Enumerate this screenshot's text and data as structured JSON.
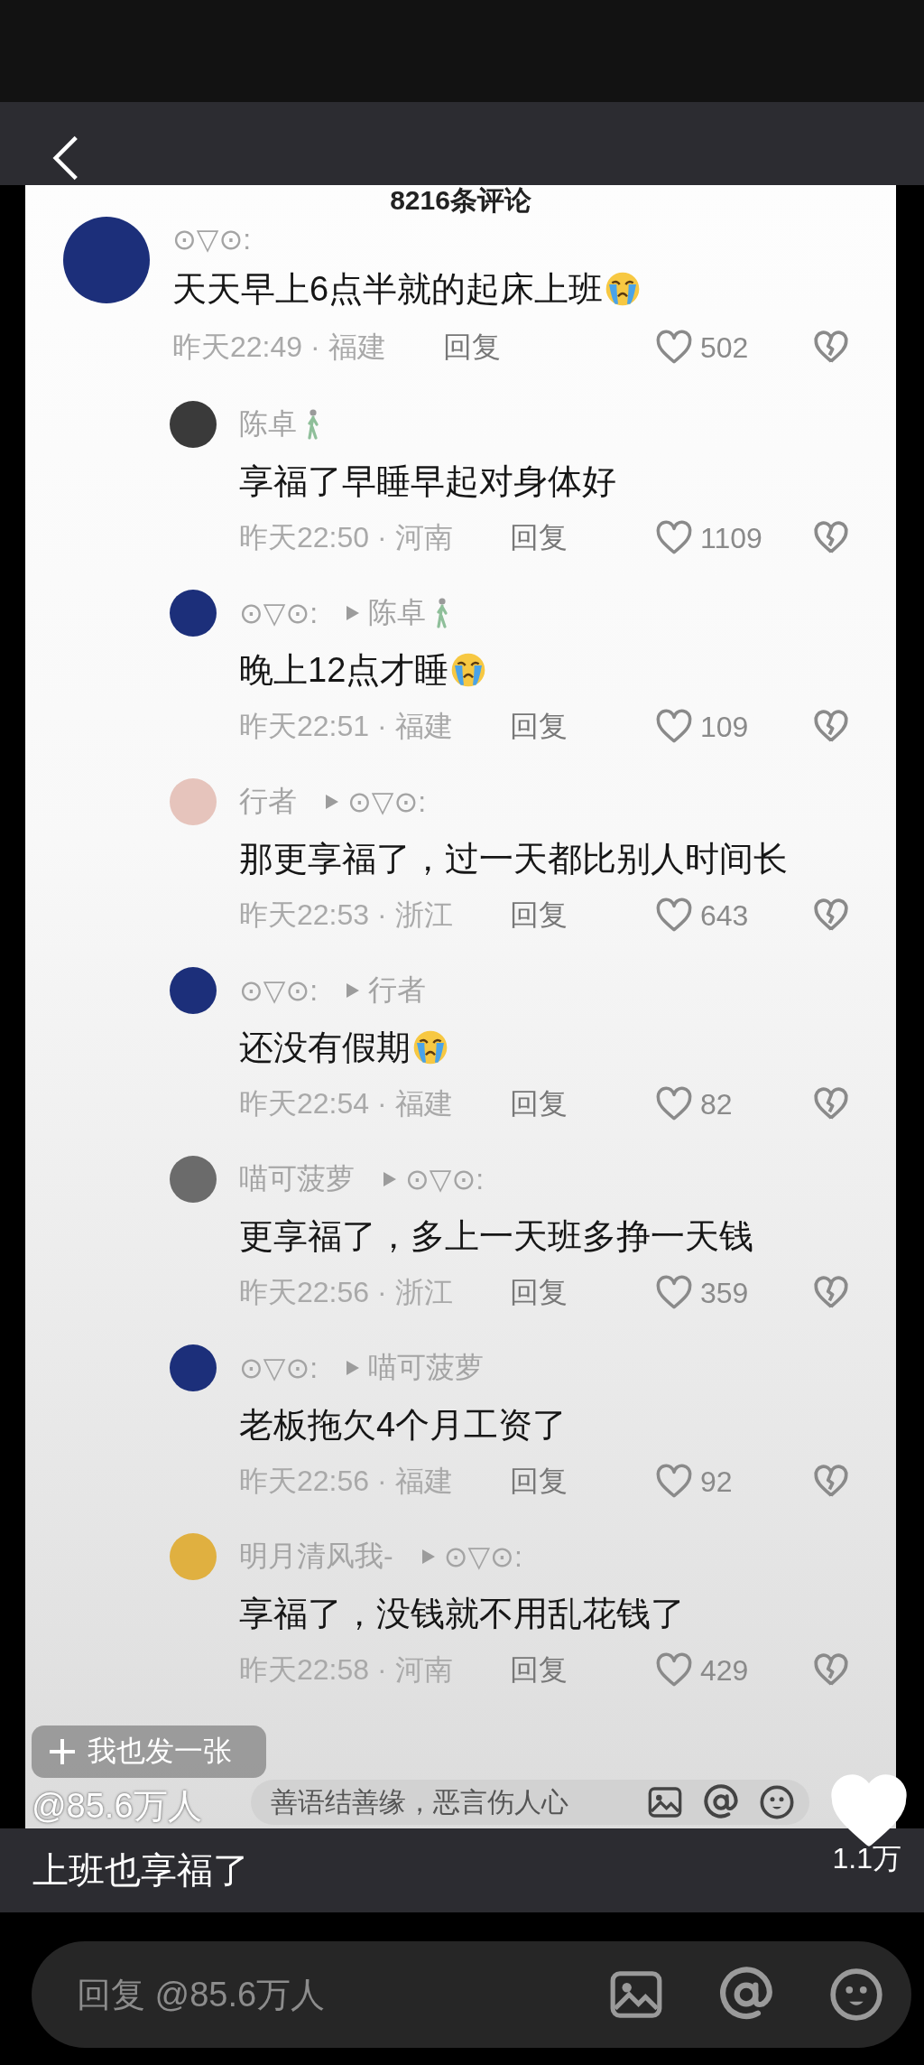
{
  "header": {
    "title": "8216条评论"
  },
  "comments": [
    {
      "kind": "comment",
      "color": "#1c2f7a",
      "name": "⊙▽⊙:",
      "text": "天天早上6点半就的起床上班",
      "emoji": true,
      "meta": "昨天22:49 · 福建",
      "reply": "回复",
      "likes": "502"
    },
    {
      "kind": "reply",
      "color": "#3a3a3a",
      "name": "陈卓",
      "name_badge": true,
      "text": "享福了早睡早起对身体好",
      "meta": "昨天22:50 · 河南",
      "reply": "回复",
      "likes": "1109"
    },
    {
      "kind": "reply",
      "color": "#1c2f7a",
      "name": "⊙▽⊙:",
      "reply_to": "陈卓",
      "reply_to_badge": true,
      "text": "晚上12点才睡",
      "emoji": true,
      "meta": "昨天22:51 · 福建",
      "reply": "回复",
      "likes": "109"
    },
    {
      "kind": "reply",
      "color": "#e6c4bc",
      "name": "行者",
      "reply_to": "⊙▽⊙:",
      "text": "那更享福了，过一天都比别人时间长",
      "meta": "昨天22:53 · 浙江",
      "reply": "回复",
      "likes": "643"
    },
    {
      "kind": "reply",
      "color": "#1c2f7a",
      "name": "⊙▽⊙:",
      "reply_to": "行者",
      "text": "还没有假期",
      "emoji": true,
      "meta": "昨天22:54 · 福建",
      "reply": "回复",
      "likes": "82"
    },
    {
      "kind": "reply",
      "color": "#6b6b6b",
      "name": "喵可菠萝",
      "reply_to": "⊙▽⊙:",
      "text": "更享福了，多上一天班多挣一天钱",
      "meta": "昨天22:56 · 浙江",
      "reply": "回复",
      "likes": "359"
    },
    {
      "kind": "reply",
      "color": "#1c2f7a",
      "name": "⊙▽⊙:",
      "reply_to": "喵可菠萝",
      "text": "老板拖欠4个月工资了",
      "meta": "昨天22:56 · 福建",
      "reply": "回复",
      "likes": "92"
    },
    {
      "kind": "reply",
      "color": "#e0b040",
      "name": "明月清风我-",
      "reply_to": "⊙▽⊙:",
      "text": "享福了，没钱就不用乱花钱了",
      "meta": "昨天22:58 · 河南",
      "reply": "回复",
      "likes": "429"
    }
  ],
  "image_input": {
    "placeholder": "善语结善缘，恶言伤人心"
  },
  "overlay": {
    "post_button": "我也发一张",
    "author": "@85.6万人"
  },
  "caption": {
    "title": "上班也享福了",
    "likes": "1.1万"
  },
  "reply_box": {
    "placeholder": "回复 @85.6万人"
  }
}
